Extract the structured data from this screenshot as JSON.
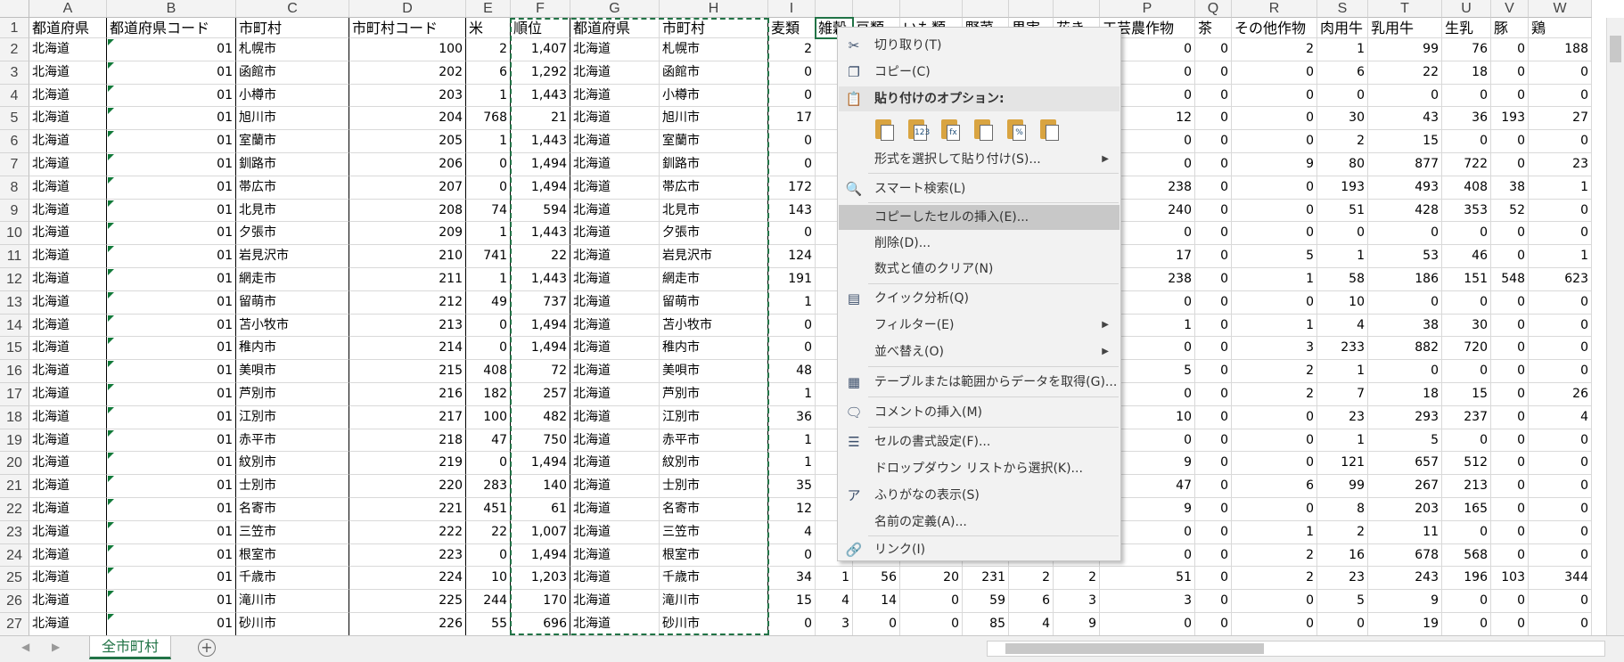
{
  "sheet": {
    "columns": [
      "A",
      "B",
      "C",
      "D",
      "E",
      "F",
      "G",
      "H",
      "I",
      "",
      "",
      "",
      "",
      "",
      "",
      "P",
      "Q",
      "R",
      "S",
      "T",
      "U",
      "V",
      "W"
    ],
    "header_row": [
      "都道府県",
      "都道府県コード",
      "市町村",
      "市町村コード",
      "米",
      "順位",
      "都道府県",
      "市町村",
      "麦類",
      "雑穀",
      "豆類",
      "いも類",
      "野菜",
      "果実",
      "花き",
      "工芸農作物",
      "茶",
      "その他作物",
      "肉用牛",
      "乳用牛",
      "生乳",
      "豚",
      "鶏"
    ],
    "rows": [
      {
        "n": "2",
        "pref": "北海道",
        "code": "01",
        "city": "札幌市",
        "ccode": "100",
        "rice": "2",
        "rank": "1,407",
        "pref2": "北海道",
        "city2": "札幌市",
        "wheat": "2",
        "p": "0",
        "q": "0",
        "r": "2",
        "s": "1",
        "t": "99",
        "u": "76",
        "v": "0",
        "w": "188"
      },
      {
        "n": "3",
        "pref": "北海道",
        "code": "01",
        "city": "函館市",
        "ccode": "202",
        "rice": "6",
        "rank": "1,292",
        "pref2": "北海道",
        "city2": "函館市",
        "wheat": "0",
        "p": "0",
        "q": "0",
        "r": "0",
        "s": "6",
        "t": "22",
        "u": "18",
        "v": "0",
        "w": "0"
      },
      {
        "n": "4",
        "pref": "北海道",
        "code": "01",
        "city": "小樽市",
        "ccode": "203",
        "rice": "1",
        "rank": "1,443",
        "pref2": "北海道",
        "city2": "小樽市",
        "wheat": "0",
        "p": "0",
        "q": "0",
        "r": "0",
        "s": "0",
        "t": "0",
        "u": "0",
        "v": "0",
        "w": "0"
      },
      {
        "n": "5",
        "pref": "北海道",
        "code": "01",
        "city": "旭川市",
        "ccode": "204",
        "rice": "768",
        "rank": "21",
        "pref2": "北海道",
        "city2": "旭川市",
        "wheat": "17",
        "p": "12",
        "q": "0",
        "r": "0",
        "s": "30",
        "t": "43",
        "u": "36",
        "v": "193",
        "w": "27"
      },
      {
        "n": "6",
        "pref": "北海道",
        "code": "01",
        "city": "室蘭市",
        "ccode": "205",
        "rice": "1",
        "rank": "1,443",
        "pref2": "北海道",
        "city2": "室蘭市",
        "wheat": "0",
        "p": "0",
        "q": "0",
        "r": "0",
        "s": "2",
        "t": "15",
        "u": "0",
        "v": "0",
        "w": "0"
      },
      {
        "n": "7",
        "pref": "北海道",
        "code": "01",
        "city": "釧路市",
        "ccode": "206",
        "rice": "0",
        "rank": "1,494",
        "pref2": "北海道",
        "city2": "釧路市",
        "wheat": "0",
        "p": "0",
        "q": "0",
        "r": "9",
        "s": "80",
        "t": "877",
        "u": "722",
        "v": "0",
        "w": "23"
      },
      {
        "n": "8",
        "pref": "北海道",
        "code": "01",
        "city": "帯広市",
        "ccode": "207",
        "rice": "0",
        "rank": "1,494",
        "pref2": "北海道",
        "city2": "帯広市",
        "wheat": "172",
        "p": "238",
        "q": "0",
        "r": "0",
        "s": "193",
        "t": "493",
        "u": "408",
        "v": "38",
        "w": "1"
      },
      {
        "n": "9",
        "pref": "北海道",
        "code": "01",
        "city": "北見市",
        "ccode": "208",
        "rice": "74",
        "rank": "594",
        "pref2": "北海道",
        "city2": "北見市",
        "wheat": "143",
        "p": "240",
        "q": "0",
        "r": "0",
        "s": "51",
        "t": "428",
        "u": "353",
        "v": "52",
        "w": "0"
      },
      {
        "n": "10",
        "pref": "北海道",
        "code": "01",
        "city": "夕張市",
        "ccode": "209",
        "rice": "1",
        "rank": "1,443",
        "pref2": "北海道",
        "city2": "夕張市",
        "wheat": "0",
        "p": "0",
        "q": "0",
        "r": "0",
        "s": "0",
        "t": "0",
        "u": "0",
        "v": "0",
        "w": "0"
      },
      {
        "n": "11",
        "pref": "北海道",
        "code": "01",
        "city": "岩見沢市",
        "ccode": "210",
        "rice": "741",
        "rank": "22",
        "pref2": "北海道",
        "city2": "岩見沢市",
        "wheat": "124",
        "p": "17",
        "q": "0",
        "r": "5",
        "s": "1",
        "t": "53",
        "u": "46",
        "v": "0",
        "w": "1"
      },
      {
        "n": "12",
        "pref": "北海道",
        "code": "01",
        "city": "網走市",
        "ccode": "211",
        "rice": "1",
        "rank": "1,443",
        "pref2": "北海道",
        "city2": "網走市",
        "wheat": "191",
        "p": "238",
        "q": "0",
        "r": "1",
        "s": "58",
        "t": "186",
        "u": "151",
        "v": "548",
        "w": "623"
      },
      {
        "n": "13",
        "pref": "北海道",
        "code": "01",
        "city": "留萌市",
        "ccode": "212",
        "rice": "49",
        "rank": "737",
        "pref2": "北海道",
        "city2": "留萌市",
        "wheat": "1",
        "p": "0",
        "q": "0",
        "r": "0",
        "s": "10",
        "t": "0",
        "u": "0",
        "v": "0",
        "w": "0"
      },
      {
        "n": "14",
        "pref": "北海道",
        "code": "01",
        "city": "苫小牧市",
        "ccode": "213",
        "rice": "0",
        "rank": "1,494",
        "pref2": "北海道",
        "city2": "苫小牧市",
        "wheat": "0",
        "p": "1",
        "q": "0",
        "r": "1",
        "s": "4",
        "t": "38",
        "u": "30",
        "v": "0",
        "w": "0"
      },
      {
        "n": "15",
        "pref": "北海道",
        "code": "01",
        "city": "稚内市",
        "ccode": "214",
        "rice": "0",
        "rank": "1,494",
        "pref2": "北海道",
        "city2": "稚内市",
        "wheat": "0",
        "p": "0",
        "q": "0",
        "r": "3",
        "s": "233",
        "t": "882",
        "u": "720",
        "v": "0",
        "w": "0"
      },
      {
        "n": "16",
        "pref": "北海道",
        "code": "01",
        "city": "美唄市",
        "ccode": "215",
        "rice": "408",
        "rank": "72",
        "pref2": "北海道",
        "city2": "美唄市",
        "wheat": "48",
        "p": "5",
        "q": "0",
        "r": "2",
        "s": "1",
        "t": "0",
        "u": "0",
        "v": "0",
        "w": "0"
      },
      {
        "n": "17",
        "pref": "北海道",
        "code": "01",
        "city": "芦別市",
        "ccode": "216",
        "rice": "182",
        "rank": "257",
        "pref2": "北海道",
        "city2": "芦別市",
        "wheat": "1",
        "p": "0",
        "q": "0",
        "r": "2",
        "s": "7",
        "t": "18",
        "u": "15",
        "v": "0",
        "w": "26"
      },
      {
        "n": "18",
        "pref": "北海道",
        "code": "01",
        "city": "江別市",
        "ccode": "217",
        "rice": "100",
        "rank": "482",
        "pref2": "北海道",
        "city2": "江別市",
        "wheat": "36",
        "p": "10",
        "q": "0",
        "r": "0",
        "s": "23",
        "t": "293",
        "u": "237",
        "v": "0",
        "w": "4"
      },
      {
        "n": "19",
        "pref": "北海道",
        "code": "01",
        "city": "赤平市",
        "ccode": "218",
        "rice": "47",
        "rank": "750",
        "pref2": "北海道",
        "city2": "赤平市",
        "wheat": "1",
        "p": "0",
        "q": "0",
        "r": "0",
        "s": "1",
        "t": "5",
        "u": "0",
        "v": "0",
        "w": "0"
      },
      {
        "n": "20",
        "pref": "北海道",
        "code": "01",
        "city": "紋別市",
        "ccode": "219",
        "rice": "0",
        "rank": "1,494",
        "pref2": "北海道",
        "city2": "紋別市",
        "wheat": "1",
        "p": "9",
        "q": "0",
        "r": "0",
        "s": "121",
        "t": "657",
        "u": "512",
        "v": "0",
        "w": "0"
      },
      {
        "n": "21",
        "pref": "北海道",
        "code": "01",
        "city": "士別市",
        "ccode": "220",
        "rice": "283",
        "rank": "140",
        "pref2": "北海道",
        "city2": "士別市",
        "wheat": "35",
        "p": "47",
        "q": "0",
        "r": "6",
        "s": "99",
        "t": "267",
        "u": "213",
        "v": "0",
        "w": "0"
      },
      {
        "n": "22",
        "pref": "北海道",
        "code": "01",
        "city": "名寄市",
        "ccode": "221",
        "rice": "451",
        "rank": "61",
        "pref2": "北海道",
        "city2": "名寄市",
        "wheat": "12",
        "p": "9",
        "q": "0",
        "r": "0",
        "s": "8",
        "t": "203",
        "u": "165",
        "v": "0",
        "w": "0"
      },
      {
        "n": "23",
        "pref": "北海道",
        "code": "01",
        "city": "三笠市",
        "ccode": "222",
        "rice": "22",
        "rank": "1,007",
        "pref2": "北海道",
        "city2": "三笠市",
        "wheat": "4",
        "p": "0",
        "q": "0",
        "r": "1",
        "s": "2",
        "t": "11",
        "u": "0",
        "v": "0",
        "w": "0"
      },
      {
        "n": "24",
        "pref": "北海道",
        "code": "01",
        "city": "根室市",
        "ccode": "223",
        "rice": "0",
        "rank": "1,494",
        "pref2": "北海道",
        "city2": "根室市",
        "wheat": "0",
        "p": "0",
        "q": "0",
        "r": "2",
        "s": "16",
        "t": "678",
        "u": "568",
        "v": "0",
        "w": "0"
      },
      {
        "n": "25",
        "pref": "北海道",
        "code": "01",
        "city": "千歳市",
        "ccode": "224",
        "rice": "10",
        "rank": "1,203",
        "pref2": "北海道",
        "city2": "千歳市",
        "wheat": "34",
        "j": "1",
        "k": "56",
        "l": "20",
        "m": "231",
        "nn": "2",
        "o": "2",
        "p": "51",
        "q": "0",
        "r": "2",
        "s": "23",
        "t": "243",
        "u": "196",
        "v": "103",
        "w": "344"
      },
      {
        "n": "26",
        "pref": "北海道",
        "code": "01",
        "city": "滝川市",
        "ccode": "225",
        "rice": "244",
        "rank": "170",
        "pref2": "北海道",
        "city2": "滝川市",
        "wheat": "15",
        "j": "4",
        "k": "14",
        "l": "0",
        "m": "59",
        "nn": "6",
        "o": "3",
        "p": "3",
        "q": "0",
        "r": "0",
        "s": "5",
        "t": "9",
        "u": "0",
        "v": "0",
        "w": "0"
      },
      {
        "n": "27",
        "pref": "北海道",
        "code": "01",
        "city": "砂川市",
        "ccode": "226",
        "rice": "55",
        "rank": "696",
        "pref2": "北海道",
        "city2": "砂川市",
        "wheat": "0",
        "j": "3",
        "k": "0",
        "l": "0",
        "m": "85",
        "nn": "4",
        "o": "9",
        "p": "0",
        "q": "0",
        "r": "0",
        "s": "0",
        "t": "19",
        "u": "0",
        "v": "0",
        "w": "0"
      }
    ],
    "row1_label": "1"
  },
  "context_menu": {
    "items": [
      {
        "label": "切り取り(T)",
        "icon": "✂"
      },
      {
        "label": "コピー(C)",
        "icon": "❐"
      },
      {
        "label": "貼り付けのオプション:",
        "icon": "📋"
      },
      {
        "label": "形式を選択して貼り付け(S)..."
      },
      {
        "label": "スマート検索(L)",
        "icon": "🔍"
      },
      {
        "label": "コピーしたセルの挿入(E)..."
      },
      {
        "label": "削除(D)..."
      },
      {
        "label": "数式と値のクリア(N)"
      },
      {
        "label": "クイック分析(Q)",
        "icon": "▤"
      },
      {
        "label": "フィルター(E)"
      },
      {
        "label": "並べ替え(O)"
      },
      {
        "label": "テーブルまたは範囲からデータを取得(G)...",
        "icon": "▦"
      },
      {
        "label": "コメントの挿入(M)",
        "icon": "🗨"
      },
      {
        "label": "セルの書式設定(F)...",
        "icon": "☰"
      },
      {
        "label": "ドロップダウン リストから選択(K)..."
      },
      {
        "label": "ふりがなの表示(S)",
        "icon": "ア"
      },
      {
        "label": "名前の定義(A)..."
      },
      {
        "label": "リンク(I)",
        "icon": "🔗"
      }
    ],
    "paste_labels": [
      "",
      "123",
      "fx",
      "",
      "%",
      ""
    ]
  },
  "bottom": {
    "sheet_tab": "全市町村",
    "add_sheet": "+"
  }
}
